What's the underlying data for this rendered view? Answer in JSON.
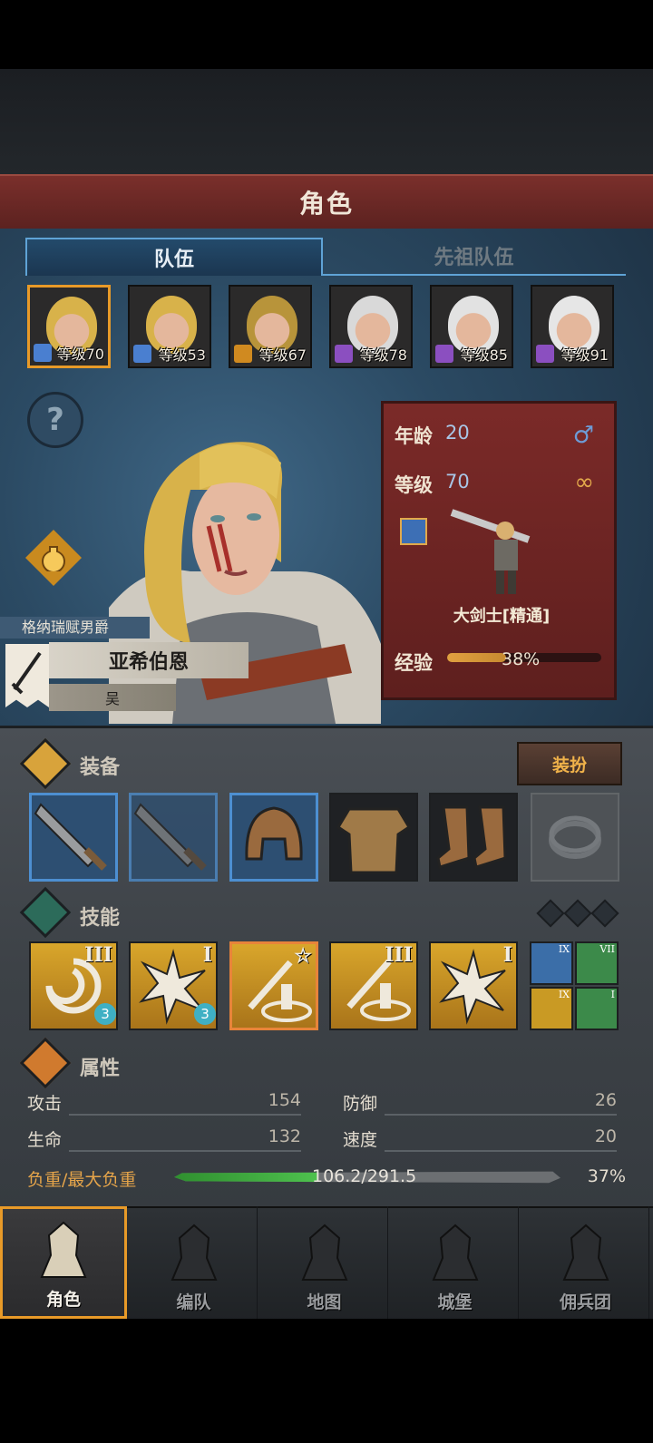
{
  "header": {
    "title": "角色"
  },
  "tabs": [
    {
      "label": "队伍",
      "active": true
    },
    {
      "label": "先祖队伍",
      "active": false
    }
  ],
  "party": [
    {
      "level_text": "等级70",
      "hair": "#d8b24a",
      "class_color": "#4a7fd0",
      "selected": true
    },
    {
      "level_text": "等级53",
      "hair": "#d8b24a",
      "class_color": "#4a7fd0",
      "selected": false
    },
    {
      "level_text": "等级67",
      "hair": "#b8943a",
      "class_color": "#d08a20",
      "selected": false
    },
    {
      "level_text": "等级78",
      "hair": "#d9d9d9",
      "class_color": "#8b4fc0",
      "selected": false
    },
    {
      "level_text": "等级85",
      "hair": "#e2e2e2",
      "class_color": "#8b4fc0",
      "selected": false
    },
    {
      "level_text": "等级91",
      "hair": "#e6e6e6",
      "class_color": "#8b4fc0",
      "selected": false
    }
  ],
  "help_icon": "?",
  "character": {
    "title": "格纳瑞赋男爵",
    "name": "亚希伯恩",
    "subname": "吴",
    "age_label": "年龄",
    "age": "20",
    "level_label": "等级",
    "level": "70",
    "sex_icon": "♂",
    "ring_icon": "∞",
    "class_name": "大剑士[精通]",
    "exp_label": "经验",
    "exp_percent_text": "38%",
    "exp_fraction": 0.38
  },
  "equipment": {
    "title": "装备",
    "dress_button": "装扮",
    "slots": [
      "greatsword",
      "greatsword-2",
      "helmet",
      "armor",
      "boots",
      "ring-empty"
    ]
  },
  "skills": {
    "title": "技能",
    "items": [
      {
        "roman": "III",
        "gem": "3",
        "icon": "whirlwind-icon"
      },
      {
        "roman": "I",
        "gem": "3",
        "icon": "burst-icon"
      },
      {
        "roman": "☆",
        "gem": "",
        "icon": "sword-aura-icon"
      },
      {
        "roman": "III",
        "gem": "",
        "icon": "sword-aura-icon"
      },
      {
        "roman": "I",
        "gem": "",
        "icon": "burst-icon"
      }
    ],
    "mini": [
      {
        "roman": "IX",
        "color": "#3b6ea8"
      },
      {
        "roman": "VII",
        "color": "#3c8a4a"
      },
      {
        "roman": "IX",
        "color": "#c99a24"
      },
      {
        "roman": "I",
        "color": "#3c8a4a"
      }
    ]
  },
  "attributes": {
    "title": "属性",
    "attack_label": "攻击",
    "attack": "154",
    "defense_label": "防御",
    "defense": "26",
    "hp_label": "生命",
    "hp": "132",
    "speed_label": "速度",
    "speed": "20",
    "load_label": "负重/最大负重",
    "load_text": "106.2/291.5",
    "load_percent_text": "37%",
    "load_fraction": 0.37
  },
  "nav": [
    {
      "label": "角色",
      "icon": "knight-icon",
      "active": true
    },
    {
      "label": "编队",
      "icon": "formation-icon",
      "active": false
    },
    {
      "label": "地图",
      "icon": "compass-map-icon",
      "active": false
    },
    {
      "label": "城堡",
      "icon": "castle-icon",
      "active": false
    },
    {
      "label": "佣兵团",
      "icon": "mercenary-icon",
      "active": false
    }
  ],
  "colors": {
    "accent": "#e89a28",
    "banner": "#7a2f2b",
    "tab_blue": "#5fa3d6"
  }
}
